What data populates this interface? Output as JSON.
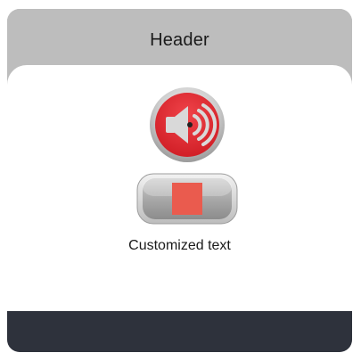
{
  "header": {
    "title": "Header"
  },
  "controls": {
    "speaker_icon": "speaker-volume-icon",
    "stop_icon": "stop-icon"
  },
  "caption": {
    "text": "Customized text"
  },
  "colors": {
    "header_bg": "#bdbdbd",
    "body_bg": "#ffffff",
    "footer_bg": "#2e323c",
    "accent_red": "#e5232b",
    "stop_square": "#ea5b4e"
  }
}
